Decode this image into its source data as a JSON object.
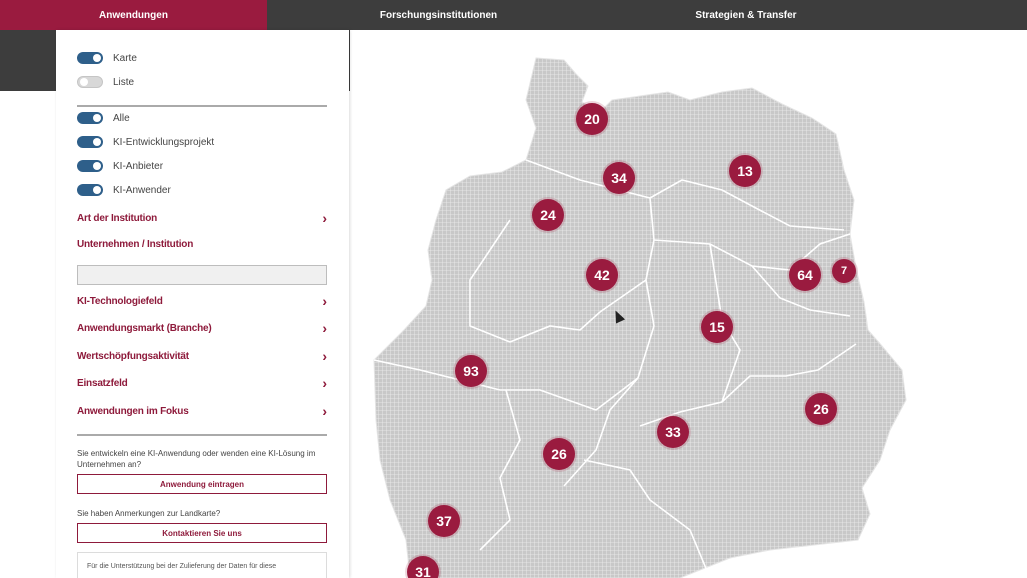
{
  "nav": {
    "tabs": [
      {
        "label": "Anwendungen",
        "active": true
      },
      {
        "label": "Forschungsinstitutionen",
        "active": false
      },
      {
        "label": "Strategien & Transfer",
        "active": false
      }
    ]
  },
  "colors": {
    "accent": "#9a1b3f",
    "nav_bg": "#3d3d3d",
    "toggle_on": "#2e5f8a",
    "map_fill": "#cfcfcf",
    "borders": "#ffffff"
  },
  "view_toggles": [
    {
      "label": "Karte",
      "on": true
    },
    {
      "label": "Liste",
      "on": false
    }
  ],
  "type_toggles": [
    {
      "label": "Alle",
      "on": true
    },
    {
      "label": "KI-Entwicklungsprojekt",
      "on": true
    },
    {
      "label": "KI-Anbieter",
      "on": true
    },
    {
      "label": "KI-Anwender",
      "on": true
    }
  ],
  "filters": {
    "art": "Art der Institution",
    "unternehmen": "Unternehmen / Institution",
    "unternehmen_placeholder": "",
    "technologie": "KI-Technologiefeld",
    "markt": "Anwendungsmarkt (Branche)",
    "wertschoepfung": "Wertschöpfungsaktivität",
    "einsatz": "Einsatzfeld",
    "fokus": "Anwendungen im Fokus"
  },
  "icons": {
    "expand": "chevron-right-icon",
    "switch": "toggle-switch-icon"
  },
  "cta": {
    "entwickeln_text": "Sie entwickeln eine KI-Anwendung oder wenden eine KI-Lösung im Unternehmen an?",
    "eintragen_button": "Anwendung eintragen",
    "anmerkungen_text": "Sie haben Anmerkungen zur Landkarte?",
    "kontakt_button": "Kontaktieren Sie uns"
  },
  "info": {
    "line1": "Für die Unterstützung bei der Zulieferung der Daten für diese"
  },
  "clusters": [
    {
      "count": "20",
      "size": "big"
    },
    {
      "count": "34",
      "size": "big"
    },
    {
      "count": "13",
      "size": "big"
    },
    {
      "count": "24",
      "size": "big"
    },
    {
      "count": "42",
      "size": "big"
    },
    {
      "count": "64",
      "size": "big"
    },
    {
      "count": "7",
      "size": "small"
    },
    {
      "count": "15",
      "size": "big"
    },
    {
      "count": "93",
      "size": "big"
    },
    {
      "count": "26",
      "size": "big"
    },
    {
      "count": "33",
      "size": "big"
    },
    {
      "count": "26",
      "size": "big"
    },
    {
      "count": "37",
      "size": "big"
    },
    {
      "count": "31",
      "size": "big"
    }
  ]
}
